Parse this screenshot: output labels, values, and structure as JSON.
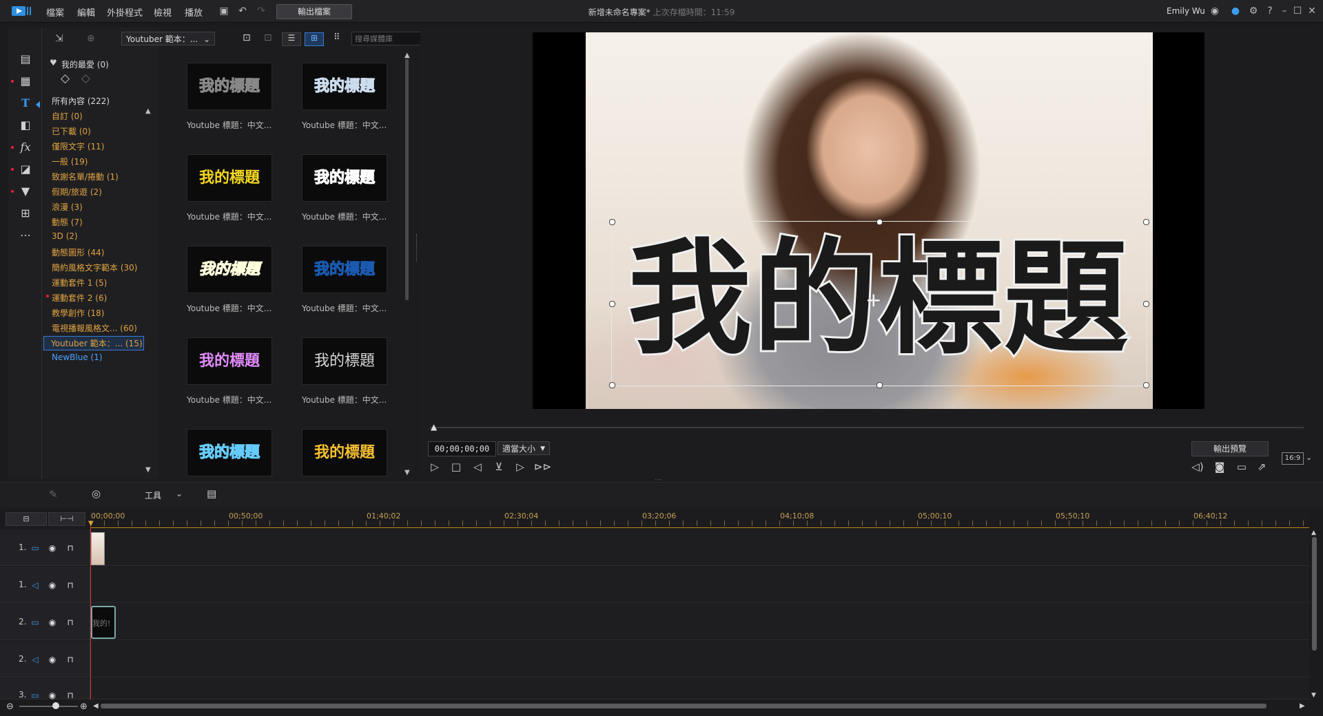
{
  "app": {
    "menu": [
      "檔案",
      "編輯",
      "外掛程式",
      "檢視",
      "播放"
    ],
    "produce_label": "輸出檔案",
    "project_title": "新增未命名專案*",
    "last_saved": "上次存檔時間：11:59",
    "username": "Emily Wu"
  },
  "library": {
    "dropdown": "Youtuber 範本：...",
    "search_placeholder": "搜尋媒體庫",
    "categories": [
      {
        "label": "我的最愛 (0)"
      },
      {
        "label": "所有內容 (222)"
      },
      {
        "label": "自訂 (0)"
      },
      {
        "label": "已下載 (0)"
      },
      {
        "label": "僅限文字 (11)"
      },
      {
        "label": "一般 (19)"
      },
      {
        "label": "致謝名單/捲動 (1)"
      },
      {
        "label": "假期/旅遊 (2)"
      },
      {
        "label": "浪漫 (3)"
      },
      {
        "label": "動態 (7)"
      },
      {
        "label": "3D (2)"
      },
      {
        "label": "動態圖形 (44)"
      },
      {
        "label": "簡約風格文字範本 (30)"
      },
      {
        "label": "運動套件 1 (5)"
      },
      {
        "label": "運動套件 2 (6)"
      },
      {
        "label": "教學創作 (18)"
      },
      {
        "label": "電視播報風格文... (60)"
      },
      {
        "label": "Youtuber 範本：... (15)"
      },
      {
        "label": "NewBlue (1)"
      }
    ],
    "thumb_text": "我的標題",
    "thumb_label": "Youtube 標題：中文..."
  },
  "preview": {
    "title_text": "我的標題",
    "timecode": "00;00;00;00",
    "fit": "適當大小",
    "produce_preview": "輸出預覽",
    "aspect": "16:9"
  },
  "timeline": {
    "tools_label": "工具",
    "ruler": [
      "00;00;00",
      "00;50;00",
      "01;40;02",
      "02;30;04",
      "03;20;06",
      "04;10;08",
      "05;00;10",
      "05;50;10",
      "06;40;12"
    ],
    "tracks": [
      "1.",
      "1.",
      "2.",
      "2.",
      "3."
    ],
    "clip_text": "我的!"
  },
  "colors": {
    "accent": "#3a7bd5",
    "category": "#e0a340",
    "ruler": "#c7a054",
    "playhead": "#dd3333"
  }
}
